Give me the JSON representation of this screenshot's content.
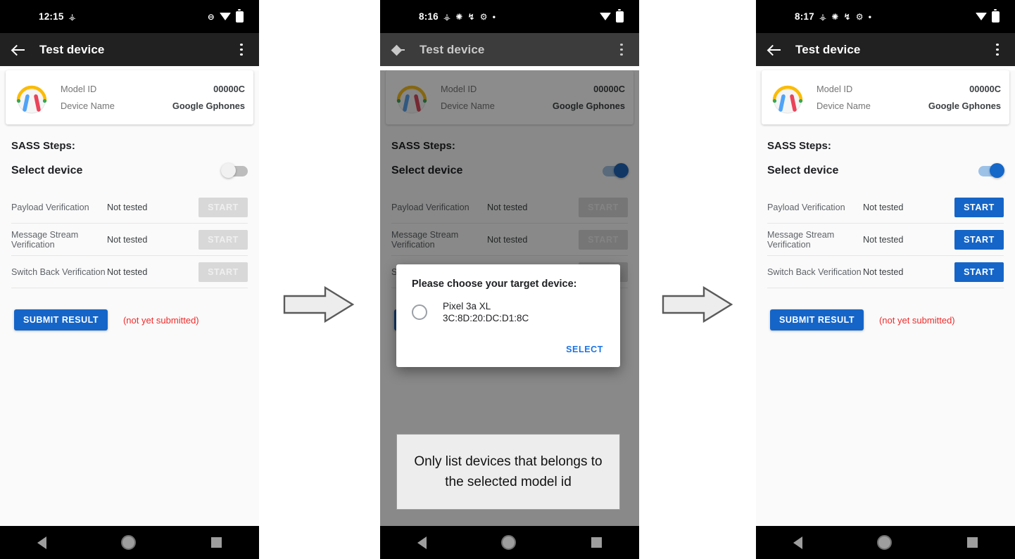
{
  "panels": [
    {
      "id": "panel-initial",
      "statusbar": {
        "time": "12:15",
        "left_icons": [
          "android-debug-icon"
        ],
        "right_icons": [
          "do-not-disturb-icon",
          "wifi-icon",
          "battery-icon"
        ]
      },
      "appbar": {
        "title": "Test device",
        "back_icon": "back-arrow-icon",
        "menu_icon": "overflow-menu-icon"
      },
      "device_card": {
        "icon": "headphones-icon",
        "rows": [
          {
            "key": "Model ID",
            "value": "00000C"
          },
          {
            "key": "Device Name",
            "value": "Google Gphones"
          }
        ]
      },
      "steps_title": "SASS Steps:",
      "select_device": {
        "label": "Select device",
        "toggle_state": "off"
      },
      "tests": [
        {
          "name": "Payload Verification",
          "status": "Not tested",
          "button": "START",
          "enabled": false
        },
        {
          "name": "Message Stream Verification",
          "status": "Not tested",
          "button": "START",
          "enabled": false
        },
        {
          "name": "Switch Back Verification",
          "status": "Not tested",
          "button": "START",
          "enabled": false
        }
      ],
      "submit": {
        "label": "SUBMIT RESULT",
        "note": "(not yet submitted)"
      },
      "dialog": null,
      "callout": null
    },
    {
      "id": "panel-dialog",
      "statusbar": {
        "time": "8:16",
        "left_icons": [
          "android-debug-icon",
          "sync-icon",
          "bluetooth-icon",
          "gear-icon",
          "dot-icon"
        ],
        "right_icons": [
          "wifi-icon",
          "battery-icon"
        ]
      },
      "appbar": {
        "title": "Test device",
        "back_icon": "back-arrow-icon",
        "menu_icon": "overflow-menu-icon"
      },
      "device_card": {
        "icon": "headphones-icon",
        "rows": [
          {
            "key": "Model ID",
            "value": "00000C"
          },
          {
            "key": "Device Name",
            "value": "Google Gphones"
          }
        ]
      },
      "steps_title": "SASS Steps:",
      "select_device": {
        "label": "Select device",
        "toggle_state": "on"
      },
      "tests": [
        {
          "name": "Payload Verification",
          "status": "Not tested",
          "button": "START",
          "enabled": false
        },
        {
          "name": "Message Stream Verification",
          "status": "Not tested",
          "button": "START",
          "enabled": false
        },
        {
          "name": "Switch Back Verification",
          "status": "Not tested",
          "button": "START",
          "enabled": false
        }
      ],
      "submit": {
        "label": "SUBMIT RESULT",
        "note": "(not yet submitted)"
      },
      "dialog": {
        "title": "Please choose your target device:",
        "option": {
          "name": "Pixel 3a XL",
          "mac": "3C:8D:20:DC:D1:8C",
          "selected": false
        },
        "action": "SELECT"
      },
      "callout": {
        "text": "Only list devices that belongs to the selected model id"
      }
    },
    {
      "id": "panel-enabled",
      "statusbar": {
        "time": "8:17",
        "left_icons": [
          "android-debug-icon",
          "sync-icon",
          "bluetooth-icon",
          "gear-icon",
          "dot-icon"
        ],
        "right_icons": [
          "wifi-icon",
          "battery-icon"
        ]
      },
      "appbar": {
        "title": "Test device",
        "back_icon": "back-arrow-icon",
        "menu_icon": "overflow-menu-icon"
      },
      "device_card": {
        "icon": "headphones-icon",
        "rows": [
          {
            "key": "Model ID",
            "value": "00000C"
          },
          {
            "key": "Device Name",
            "value": "Google Gphones"
          }
        ]
      },
      "steps_title": "SASS Steps:",
      "select_device": {
        "label": "Select device",
        "toggle_state": "on"
      },
      "tests": [
        {
          "name": "Payload Verification",
          "status": "Not tested",
          "button": "START",
          "enabled": true
        },
        {
          "name": "Message Stream Verification",
          "status": "Not tested",
          "button": "START",
          "enabled": true
        },
        {
          "name": "Switch Back Verification",
          "status": "Not tested",
          "button": "START",
          "enabled": true
        }
      ],
      "submit": {
        "label": "SUBMIT RESULT",
        "note": "(not yet submitted)"
      },
      "dialog": null,
      "callout": null
    }
  ],
  "navbar": {
    "back_icon": "nav-back-icon",
    "home_icon": "nav-home-icon",
    "recents_icon": "nav-recents-icon"
  },
  "flow_arrows": [
    {
      "name": "flow-arrow-1"
    },
    {
      "name": "flow-arrow-2"
    }
  ],
  "colors": {
    "accent_blue": "#1565C8",
    "link_blue": "#1A73E8",
    "error_red": "#EF2B2B",
    "appbar_dark": "#212121",
    "disabled_gray": "#D8D8D8",
    "callout_bg": "#EDEDED"
  }
}
